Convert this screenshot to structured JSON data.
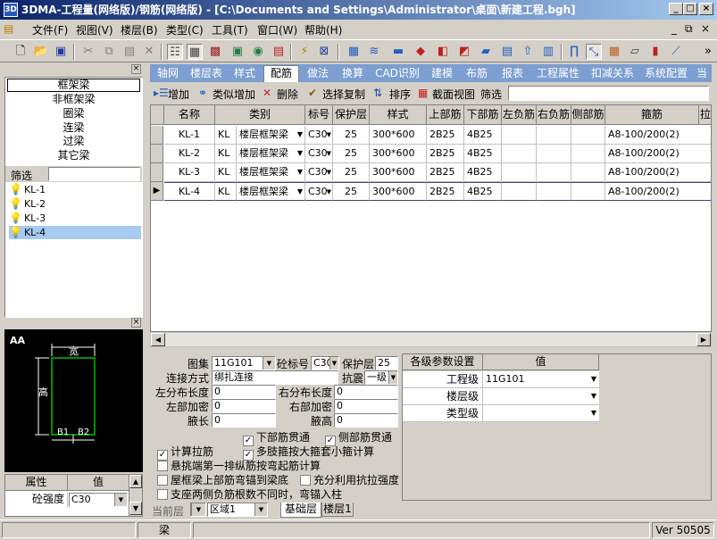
{
  "window": {
    "title": "3DMA-工程量(网络版)/钢筋(网络版) - [C:\\Documents and Settings\\Administrator\\桌面\\新建工程.bgh]",
    "app_icon": "3D"
  },
  "menu": [
    "文件(F)",
    "视图(V)",
    "楼层(B)",
    "类型(C)",
    "工具(T)",
    "窗口(W)",
    "帮助(H)"
  ],
  "mdi_controls": [
    "_",
    "⧉",
    "×"
  ],
  "left": {
    "categories": [
      "框架梁",
      "非框架梁",
      "圈梁",
      "连梁",
      "过梁",
      "其它梁"
    ],
    "selected_category": "框架梁",
    "filter_label": "筛选",
    "items": [
      "KL-1",
      "KL-2",
      "KL-3",
      "KL-4"
    ],
    "selected_item": "KL-4",
    "preview": {
      "width_label": "宽",
      "height_label": "高",
      "b1": "B1",
      "b2": "B2"
    },
    "props": {
      "header": [
        "属性",
        "值"
      ],
      "row": {
        "name": "砼强度",
        "value": "C30"
      }
    }
  },
  "tabs": [
    "轴网",
    "楼层表",
    "样式",
    "配筋",
    "做法",
    "换算",
    "CAD识别",
    "建模",
    "布筋",
    "报表",
    "工程属性",
    "扣减关系",
    "系统配置",
    "当"
  ],
  "active_tab": "配筋",
  "subbar": {
    "add": "增加",
    "similar_add": "类似增加",
    "delete": "删除",
    "select_copy": "选择复制",
    "sort": "排序",
    "section_view": "截面视图",
    "filter": "筛选"
  },
  "grid": {
    "headers": [
      "名称",
      "类别",
      "标号",
      "保护层",
      "样式",
      "上部筋",
      "下部筋",
      "左负筋",
      "右负筋",
      "侧部筋",
      "箍筋",
      "拉"
    ],
    "rows": [
      {
        "name": "KL-1",
        "code": "KL",
        "type": "楼层框架梁",
        "grade": "C30",
        "cover": "25",
        "style": "300*600",
        "top": "2B25",
        "bottom": "4B25",
        "left_neg": "",
        "right_neg": "",
        "side": "",
        "stirrup": "A8-100/200(2)"
      },
      {
        "name": "KL-2",
        "code": "KL",
        "type": "楼层框架梁",
        "grade": "C30",
        "cover": "25",
        "style": "300*600",
        "top": "2B25",
        "bottom": "4B25",
        "left_neg": "",
        "right_neg": "",
        "side": "",
        "stirrup": "A8-100/200(2)"
      },
      {
        "name": "KL-3",
        "code": "KL",
        "type": "楼层框架梁",
        "grade": "C30",
        "cover": "25",
        "style": "300*600",
        "top": "2B25",
        "bottom": "4B25",
        "left_neg": "",
        "right_neg": "",
        "side": "",
        "stirrup": "A8-100/200(2)"
      },
      {
        "name": "KL-4",
        "code": "KL",
        "type": "楼层框架梁",
        "grade": "C30",
        "cover": "25",
        "style": "300*600",
        "top": "2B25",
        "bottom": "4B25",
        "left_neg": "",
        "right_neg": "",
        "side": "",
        "stirrup": "A8-100/200(2)"
      }
    ]
  },
  "form": {
    "atlas_label": "图集",
    "atlas": "11G101",
    "concrete_label": "砼标号",
    "concrete": "C30",
    "cover_label": "保护层",
    "cover": "25",
    "connect_label": "连接方式",
    "connect": "绑扎连接",
    "seismic_label": "抗震",
    "seismic": "一级",
    "left_dist_label": "左分布长度",
    "left_dist": "0",
    "right_dist_label": "右分布长度",
    "right_dist": "0",
    "left_dense_label": "左部加密",
    "left_dense": "0",
    "right_dense_label": "右部加密",
    "right_dense": "0",
    "haunch_len_label": "腋长",
    "haunch_len": "0",
    "haunch_h_label": "腋高",
    "haunch_h": "0",
    "checks": [
      {
        "label": "下部筋贯通",
        "checked": true
      },
      {
        "label": "侧部筋贯通",
        "checked": true
      },
      {
        "label": "计算拉筋",
        "checked": true
      },
      {
        "label": "多肢箍按大箍套小箍计算",
        "checked": true
      },
      {
        "label": "悬挑端第一排纵筋按弯起筋计算",
        "checked": false
      },
      {
        "label": "屋框梁上部筋弯锚到梁底",
        "checked": false
      },
      {
        "label": "充分利用抗拉强度",
        "checked": false
      },
      {
        "label": "支座两侧负筋根数不同时，弯锚入柱",
        "checked": false
      }
    ]
  },
  "params": {
    "header": [
      "各级参数设置",
      "值"
    ],
    "rows": [
      {
        "name": "工程级",
        "value": "11G101"
      },
      {
        "name": "楼层级",
        "value": ""
      },
      {
        "name": "类型级",
        "value": ""
      }
    ]
  },
  "floor_bar": {
    "current_label": "当前层",
    "area": "区域1",
    "sheets": [
      "基础层",
      "楼层1"
    ]
  },
  "status": {
    "center": "梁",
    "version": "Ver 50505"
  },
  "colors": {
    "title_from": "#0a246a",
    "title_to": "#a6caf0",
    "selection": "#a6caf0",
    "tab_strip": "#7c9ed0"
  }
}
